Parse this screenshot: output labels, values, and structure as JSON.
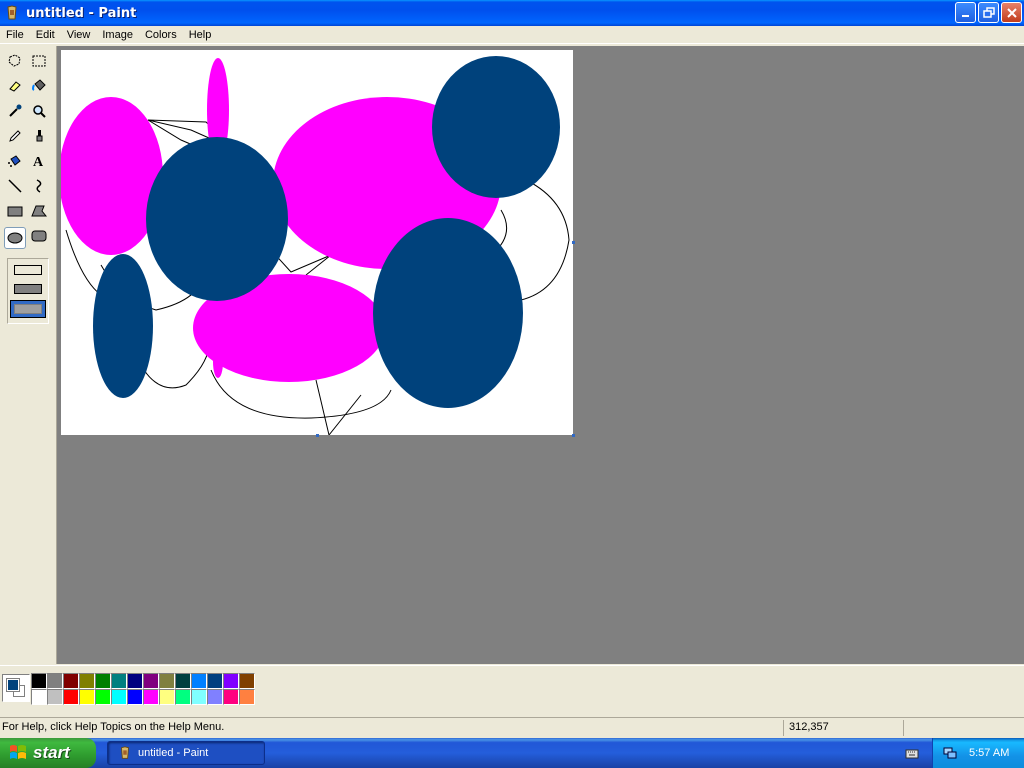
{
  "window": {
    "title": "untitled - Paint"
  },
  "menu": [
    "File",
    "Edit",
    "View",
    "Image",
    "Colors",
    "Help"
  ],
  "tools": [
    "free-form-select",
    "select",
    "eraser",
    "fill-with-color",
    "pick-color",
    "magnifier",
    "pencil",
    "brush",
    "airbrush",
    "text",
    "line",
    "curve",
    "rectangle",
    "polygon",
    "ellipse",
    "rounded-rectangle"
  ],
  "active_tool": "ellipse",
  "colors": {
    "foreground": "#00427c",
    "background": "#ffffff",
    "palette_top": [
      "#000000",
      "#808080",
      "#800000",
      "#808000",
      "#008000",
      "#008080",
      "#000080",
      "#800080",
      "#808040",
      "#004040",
      "#0080ff",
      "#004080",
      "#8000ff",
      "#804000"
    ],
    "palette_bottom": [
      "#ffffff",
      "#c0c0c0",
      "#ff0000",
      "#ffff00",
      "#00ff00",
      "#00ffff",
      "#0000ff",
      "#ff00ff",
      "#ffff80",
      "#00ff80",
      "#80ffff",
      "#8080ff",
      "#ff0080",
      "#ff8040"
    ],
    "magenta": "#ff00ff",
    "navy": "#00427c"
  },
  "status": {
    "help": "For Help, click Help Topics on the Help Menu.",
    "coords": "312,357"
  },
  "taskbar": {
    "start_label": "start",
    "task_label": "untitled - Paint",
    "clock": "5:57 AM"
  }
}
